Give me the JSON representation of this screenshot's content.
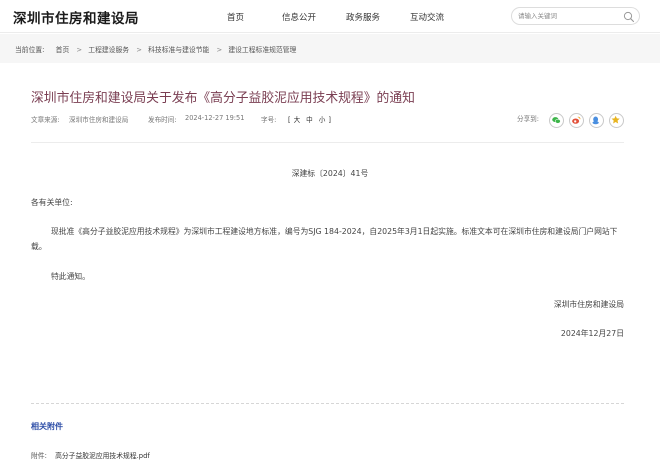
{
  "header": {
    "logo": "深圳市住房和建设局",
    "nav": [
      "首页",
      "信息公开",
      "政务服务",
      "互动交流"
    ],
    "search_placeholder": "请输入关键词"
  },
  "breadcrumb": {
    "label": "当前位置:",
    "items": [
      "首页",
      "工程建设服务",
      "科技标准与建设节能",
      "建设工程标准规范管理"
    ],
    "separator": ">"
  },
  "article": {
    "title": "深圳市住房和建设局关于发布《高分子益胶泥应用技术规程》的通知",
    "source_label": "文章来源:",
    "source": "深圳市住房和建设局",
    "time_label": "发布时间:",
    "time": "2024-12-27 19:51",
    "fontsize_label": "字号:",
    "bracket_open": "[",
    "bracket_close": "]",
    "sizes": [
      "大",
      "中",
      "小"
    ],
    "share_label": "分享到:",
    "doc_no": "深建标〔2024〕41号",
    "salutation": "各有关单位:",
    "body": "现批准《高分子益胶泥应用技术规程》为深圳市工程建设地方标准，编号为SJG 184-2024，自2025年3月1日起实施。标准文本可在深圳市住房和建设局门户网站下载。",
    "notice": "特此通知。",
    "signature_org": "深圳市住房和建设局",
    "signature_date": "2024年12月27日"
  },
  "attachments": {
    "title": "相关附件",
    "label": "附件:",
    "file": "高分子益胶泥应用技术规程.pdf"
  },
  "colors": {
    "title": "#7a3e52",
    "attach_title": "#2f4fa8",
    "wechat": "#3db54a",
    "weibo": "#e2513a",
    "qq": "#4a8fe0",
    "favorite": "#e8b420"
  }
}
